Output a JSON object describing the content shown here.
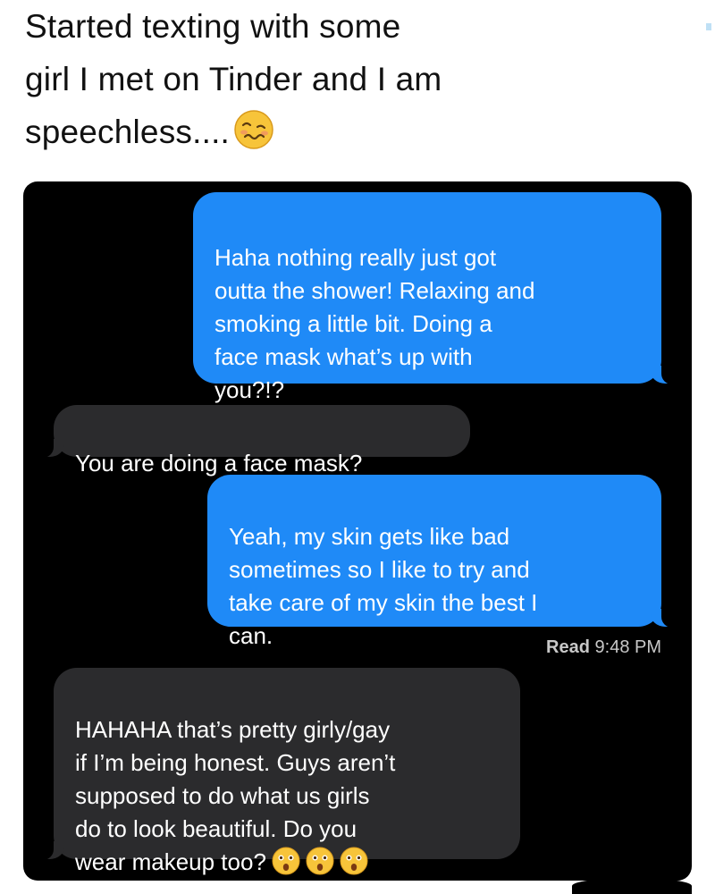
{
  "post": {
    "caption_line1": "Started texting with some",
    "caption_line2": "girl I met on Tinder and I am",
    "caption_line3": "speechless....",
    "caption_emoji": "woozy-face-emoji"
  },
  "conversation": {
    "messages": [
      {
        "direction": "sent",
        "text": "Haha nothing really just got\noutta the shower! Relaxing and\nsmoking a little bit. Doing a\nface mask what’s up with\nyou?!?"
      },
      {
        "direction": "received",
        "text": "You are doing a face mask?"
      },
      {
        "direction": "sent",
        "text": "Yeah, my skin gets like bad\nsometimes so I like to try and\ntake care of my skin the best I\ncan."
      },
      {
        "direction": "received",
        "text": "HAHAHA that’s pretty girly/gay\nif I’m being honest. Guys aren’t\nsupposed to do what us girls\ndo to look beautiful. Do you\nwear makeup too?",
        "emojis": [
          "astonished-face-emoji",
          "astonished-face-emoji",
          "astonished-face-emoji"
        ]
      }
    ],
    "read_receipt": {
      "label": "Read",
      "time": "9:48 PM"
    }
  },
  "colors": {
    "sent_bubble": "#1f8af7",
    "received_bubble": "#2b2b2d",
    "background": "#000000"
  }
}
